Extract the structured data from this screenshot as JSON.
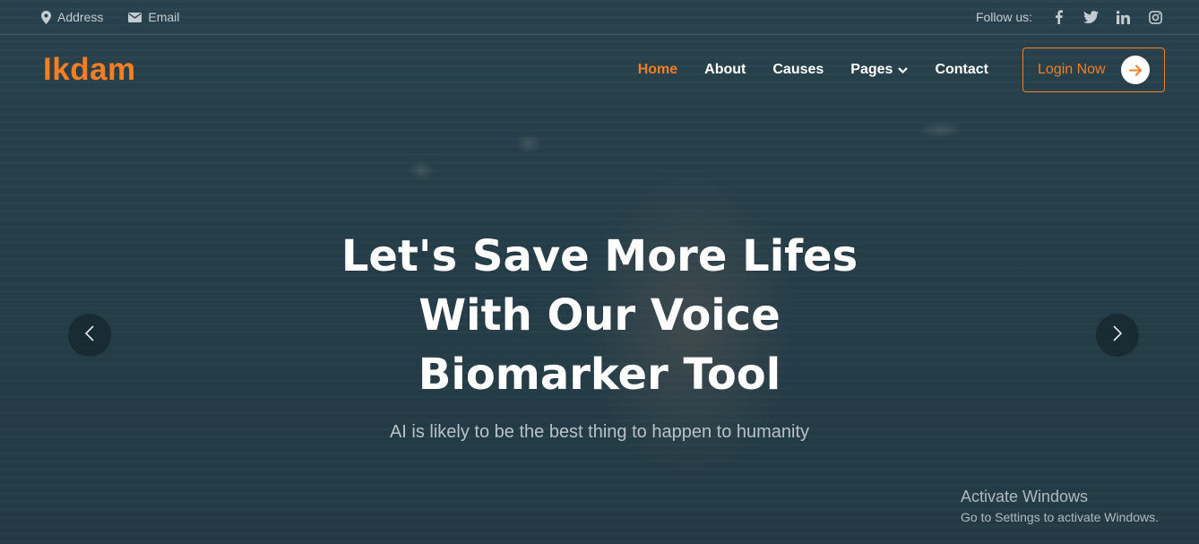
{
  "topbar": {
    "address": {
      "icon": "map-pin-icon",
      "label": "Address"
    },
    "email": {
      "icon": "envelope-icon",
      "label": "Email"
    },
    "follow_label": "Follow us:",
    "socials": [
      "facebook-icon",
      "twitter-icon",
      "linkedin-icon",
      "instagram-icon"
    ]
  },
  "brand": {
    "logo": "Ikdam",
    "accent_color": "#f47e22"
  },
  "nav": {
    "items": [
      {
        "label": "Home",
        "active": true
      },
      {
        "label": "About",
        "active": false
      },
      {
        "label": "Causes",
        "active": false
      },
      {
        "label": "Pages",
        "active": false,
        "dropdown": true
      },
      {
        "label": "Contact",
        "active": false
      }
    ],
    "login_label": "Login Now",
    "login_icon": "arrow-right-icon"
  },
  "hero": {
    "title_lines": [
      "Let's Save More Lifes",
      "With Our Voice",
      "Biomarker Tool"
    ],
    "subtitle": "AI is likely to be the best thing to happen to humanity",
    "prev_icon": "chevron-left-icon",
    "next_icon": "chevron-right-icon"
  },
  "watermark": {
    "title": "Activate Windows",
    "subtitle": "Go to Settings to activate Windows."
  }
}
